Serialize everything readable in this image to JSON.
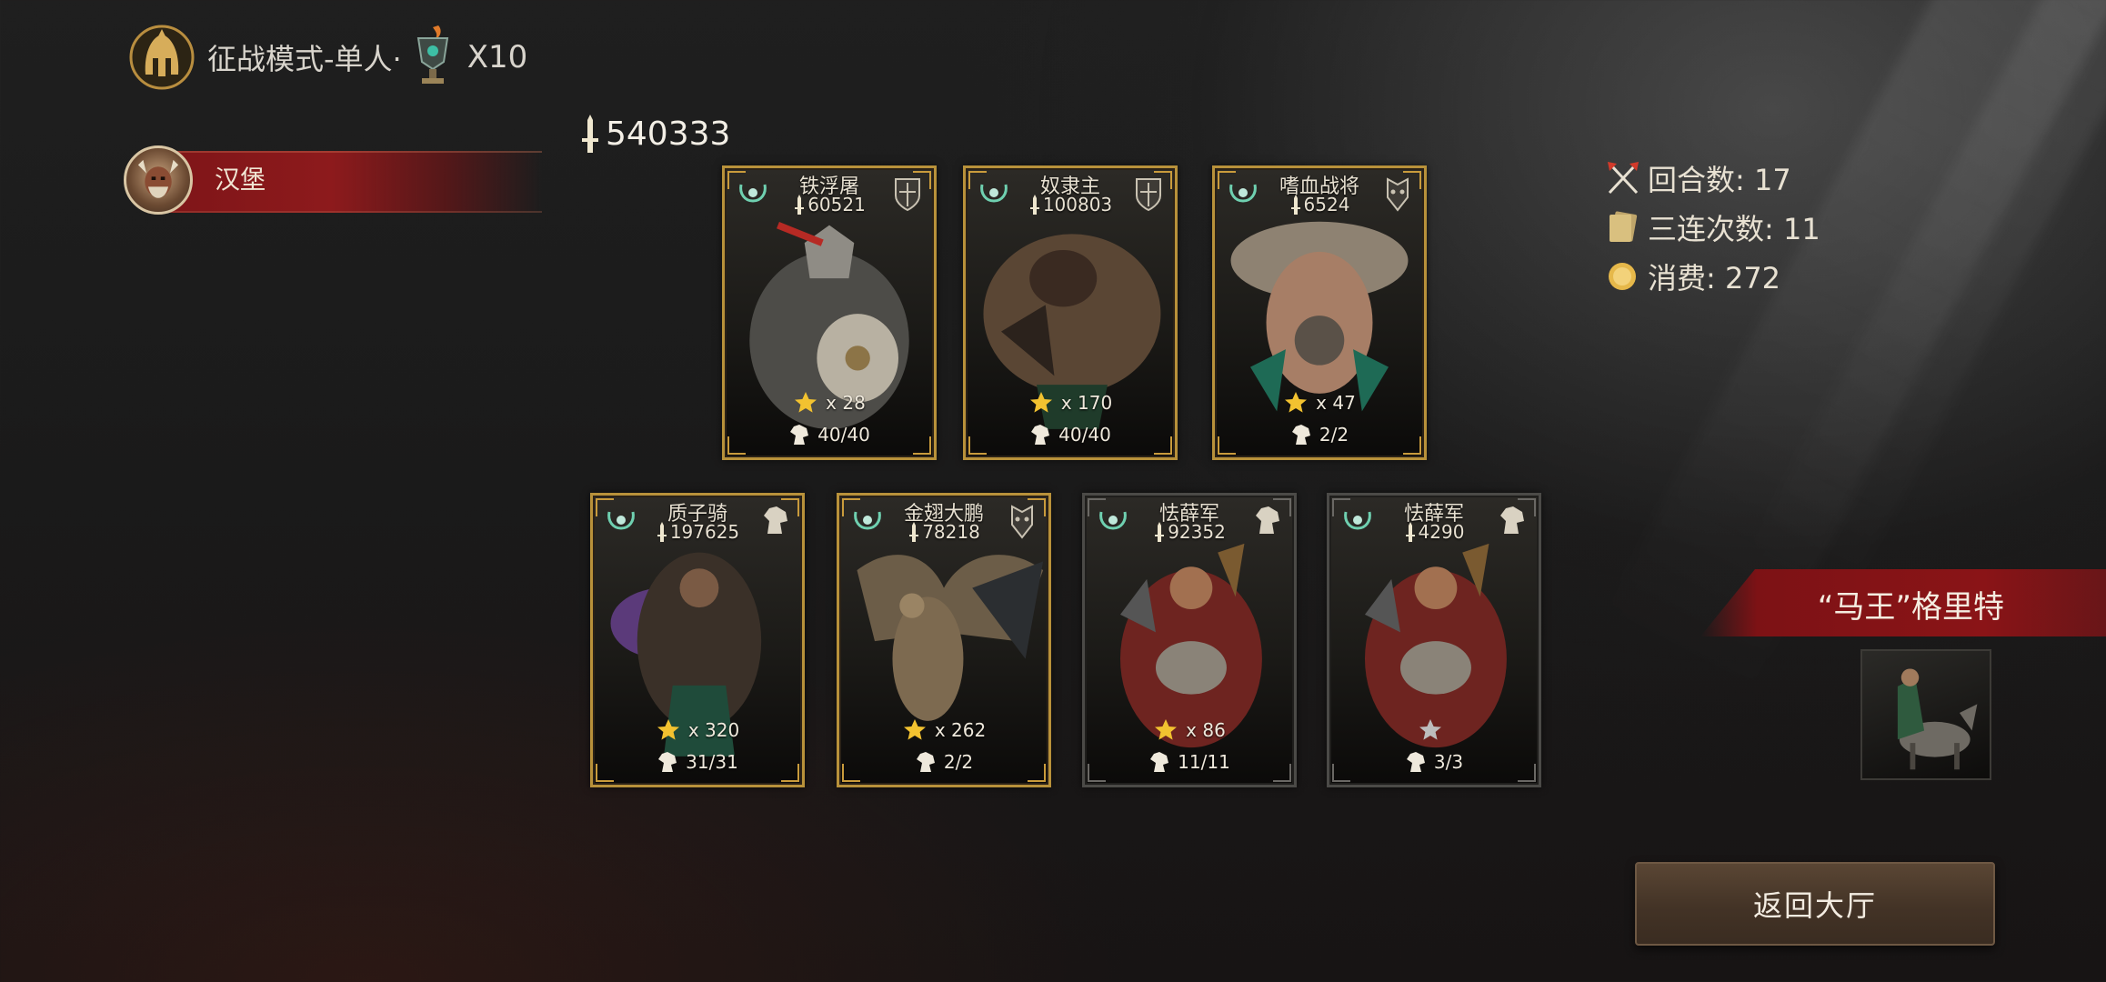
{
  "header": {
    "mode_label": "征战模式-单人·",
    "trophy_count": "X10"
  },
  "player": {
    "name": "汉堡"
  },
  "team": {
    "total_power": "540333"
  },
  "cards": [
    {
      "name": "铁浮屠",
      "power": "60521",
      "stars": "x 28",
      "troops": "40/40",
      "star_color": "#f2c230",
      "frame": "gold"
    },
    {
      "name": "奴隶主",
      "power": "100803",
      "stars": "x 170",
      "troops": "40/40",
      "star_color": "#f2c230",
      "frame": "gold"
    },
    {
      "name": "嗜血战将",
      "power": "6524",
      "stars": "x 47",
      "troops": "2/2",
      "star_color": "#f2c230",
      "frame": "gold"
    },
    {
      "name": "质子骑",
      "power": "197625",
      "stars": "x 320",
      "troops": "31/31",
      "star_color": "#f2c230",
      "frame": "gold"
    },
    {
      "name": "金翅大鹏",
      "power": "78218",
      "stars": "x 262",
      "troops": "2/2",
      "star_color": "#f2c230",
      "frame": "gold"
    },
    {
      "name": "怯薛军",
      "power": "92352",
      "stars": "x 86",
      "troops": "11/11",
      "star_color": "#f2c230",
      "frame": "silver"
    },
    {
      "name": "怯薛军",
      "power": "4290",
      "stars": "",
      "troops": "3/3",
      "star_color": "#bdbdbd",
      "frame": "silver"
    }
  ],
  "stats": {
    "rounds": "回合数: 17",
    "triples": "三连次数: 11",
    "cost": "消费: 272"
  },
  "boss": {
    "name": "“马王”格里特"
  },
  "buttons": {
    "return_label": "返回大厅"
  },
  "icons": {
    "mode_emblem": "spartan-helmet-icon",
    "trophy": "trophy-icon",
    "power": "sword-icon",
    "star": "star-icon",
    "troops": "horse-head-icon",
    "rounds": "crossed-axes-icon",
    "triples": "cards-icon",
    "cost": "coin-icon"
  }
}
